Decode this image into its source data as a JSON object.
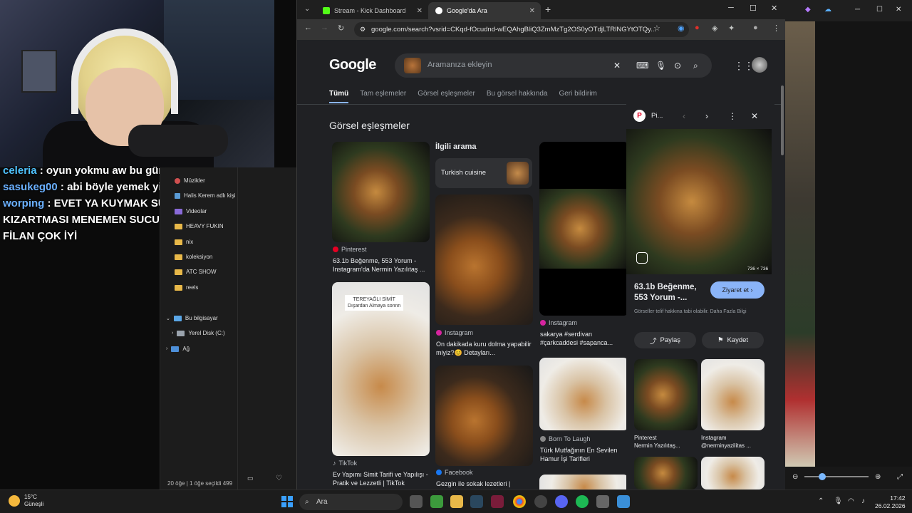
{
  "chat": [
    {
      "user": "celeria",
      "color": "#4fc3ff",
      "message": "oyun yokmu aw bu gün"
    },
    {
      "user": "sasukeg00",
      "color": "#6ab0ff",
      "message": "abi böyle yemek yiyen yoktur yaa"
    },
    {
      "user": "worping",
      "color": "#6ab0ff",
      "message": "EVET YA KUYMAK SUCUK PATATES KIZARTMASI MENEMEN SUCUKLU YUMURTA FİLAN ÇOK İYİ"
    }
  ],
  "explorer": {
    "items": [
      {
        "label": "Müzikler",
        "type": "folder"
      },
      {
        "label": "Halis Kerem adlı kişi",
        "type": "folder"
      },
      {
        "label": "Videolar",
        "type": "folder"
      },
      {
        "label": "HEAVY FUKIN",
        "type": "folder"
      },
      {
        "label": "nix",
        "type": "folder"
      },
      {
        "label": "koleksiyon",
        "type": "folder"
      },
      {
        "label": "ATC SHOW",
        "type": "folder"
      },
      {
        "label": "reels",
        "type": "folder"
      },
      {
        "label": "Bu bilgisayar",
        "type": "pc"
      },
      {
        "label": "Yerel Disk (C:)",
        "type": "disk"
      },
      {
        "label": "Ağ",
        "type": "network"
      }
    ],
    "status": "20 öğe   |   1 öğe seçildi  499"
  },
  "browser": {
    "tabs": [
      {
        "title": "Stream - Kick Dashboard",
        "active": false
      },
      {
        "title": "Google'da Ara",
        "active": true
      }
    ],
    "url": "google.com/search?vsrid=CKqd-fOcudnd-wEQAhgBliQ3ZmMzTg2OS0yOTdjLTRlNGYtOTQy...",
    "search_placeholder": "Aramanıza ekleyin",
    "nav_tabs": [
      "Tümü",
      "Tam eşlemeler",
      "Görsel eşleşmeler",
      "Bu görsel hakkında",
      "Geri bildirim"
    ],
    "section_title": "Görsel eşleşmeler",
    "related_title": "İlgili arama",
    "related_chip": "Turkish cuisine",
    "results": [
      {
        "source": "Pinterest",
        "caption": "63.1b Beğenme, 553 Yorum - Instagram'da Nermin Yazılıtaş ..."
      },
      {
        "source": "Instagram",
        "caption": "On dakikada kuru dolma yapabilir miyiz?😊 Detayları..."
      },
      {
        "source": "Instagram",
        "caption": "sakarya #serdivan #çarkcaddesi #sapanca..."
      },
      {
        "source": "TikTok",
        "caption": "Ev Yapımı Simit Tarifi ve Yapılışı - Pratik ve Lezzetli | TikTok"
      },
      {
        "source": "Facebook",
        "caption": "Gezgin ile sokak lezetleri |"
      },
      {
        "source": "Born To Laugh",
        "caption": "Türk Mutfağının En Sevilen Hamur İşi Tarifleri"
      }
    ],
    "tile_overlay": "TEREYAĞLI SİMİT\nDışardan Almaya sonnn",
    "panel": {
      "source": "Pi...",
      "dims": "736 × 736",
      "stats": "63.1b Beğenme, 553 Yorum -...",
      "visit": "Ziyaret et",
      "copyright": "Görseller telif hakkına tabi olabilir. Daha Fazla Bilgi",
      "share": "Paylaş",
      "save": "Kaydet",
      "related": [
        {
          "source": "Pinterest",
          "caption": "Nermin Yazılıtaş..."
        },
        {
          "source": "Instagram",
          "caption": "@nerminyazilitas ..."
        }
      ]
    }
  },
  "taskbar": {
    "weather_temp": "15°C",
    "weather_desc": "Güneşli",
    "search": "Ara",
    "time": "17:42",
    "date": "26.02.2026"
  }
}
